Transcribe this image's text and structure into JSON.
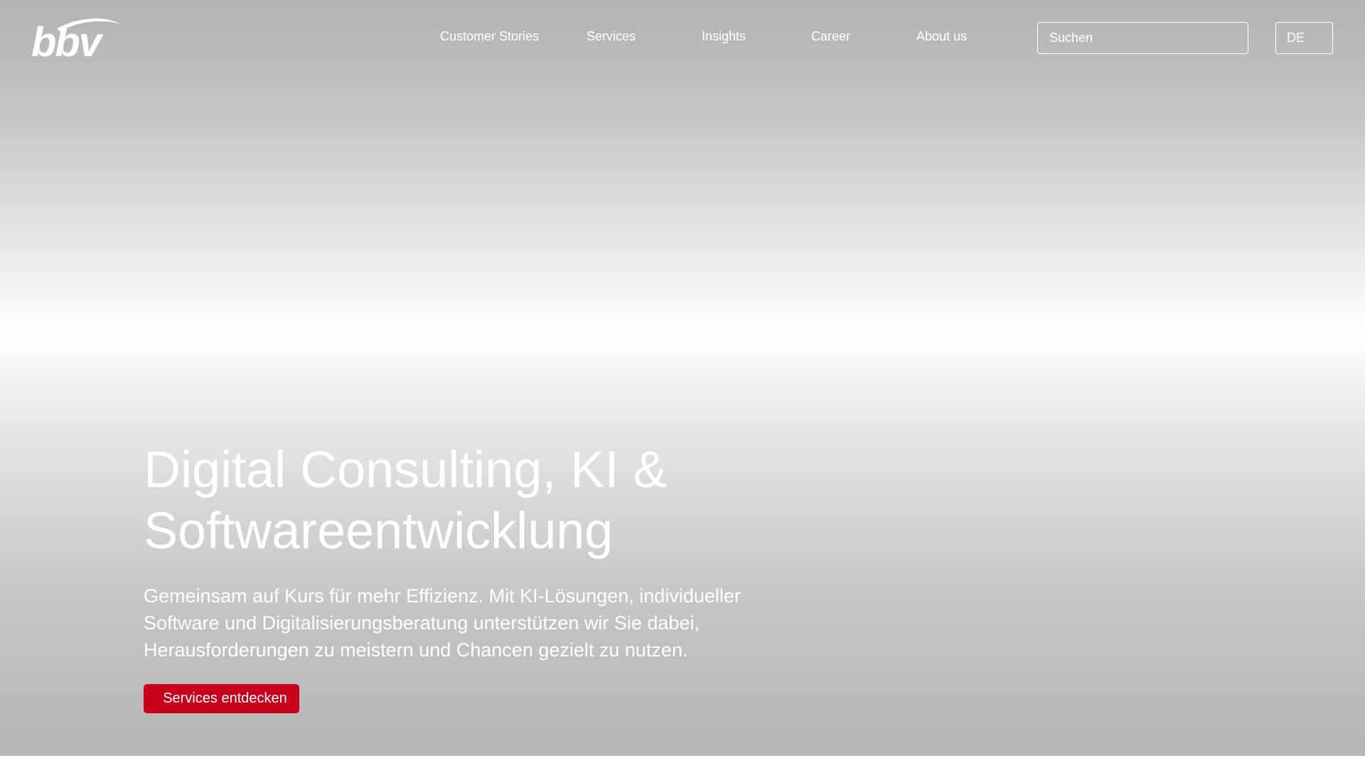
{
  "brand": {
    "logo_text": "bbv"
  },
  "nav": {
    "items": [
      {
        "label": "Customer Stories"
      },
      {
        "label": "Services"
      },
      {
        "label": "Insights"
      },
      {
        "label": "Career"
      },
      {
        "label": "About us"
      }
    ]
  },
  "search": {
    "placeholder": "Suchen",
    "value": ""
  },
  "language": {
    "selected": "DE"
  },
  "hero": {
    "headline_line1": "Digital Consulting, KI &",
    "headline_line2": "Softwareentwicklung",
    "subtext_line1": "Gemeinsam auf Kurs für mehr Effizienz. Mit KI-Lösungen, individueller",
    "subtext_line2": "Software und Digitalisierungsberatung unterstützen wir Sie dabei,",
    "subtext_line3": "Herausforderungen zu meistern und Chancen gezielt zu nutzen.",
    "cta_label": "Services entdecken"
  },
  "colors": {
    "accent": "#c8001e",
    "text_on_hero": "#ffffff"
  },
  "icons": {
    "logo": "bbv-logo-icon"
  }
}
